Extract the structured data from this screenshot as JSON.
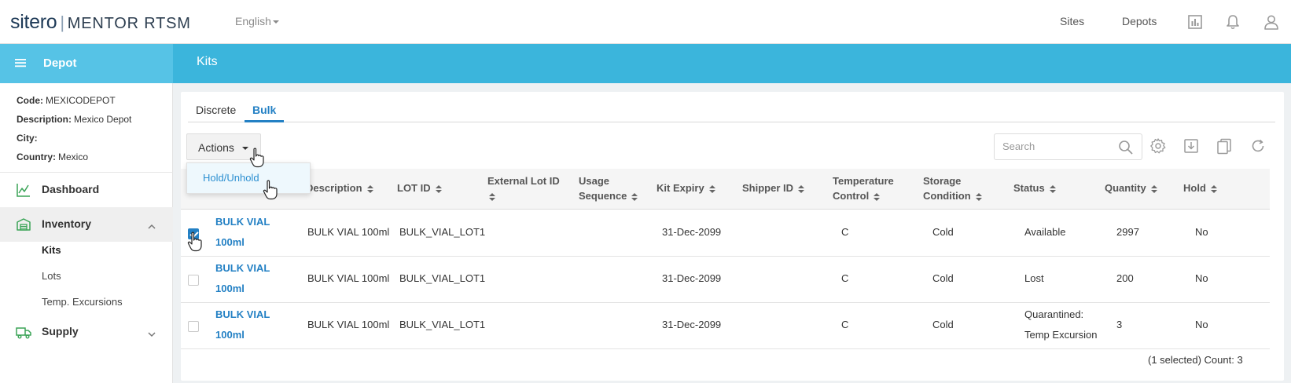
{
  "header": {
    "logo_brand": "sitero",
    "logo_separator": "|",
    "logo_product": "MENTOR RTSM",
    "language": "English",
    "nav_sites": "Sites",
    "nav_depots": "Depots",
    "icons": [
      "reports-icon",
      "bell-icon",
      "user-icon"
    ]
  },
  "sidebar": {
    "title": "Depot",
    "info": [
      {
        "label": "Code:",
        "value": "MEXICODEPOT"
      },
      {
        "label": "Description:",
        "value": "Mexico Depot"
      },
      {
        "label": "City:",
        "value": ""
      },
      {
        "label": "Country:",
        "value": "Mexico"
      }
    ],
    "nav": [
      {
        "label": "Dashboard",
        "icon": "chart-line-icon"
      },
      {
        "label": "Inventory",
        "icon": "warehouse-icon",
        "expanded": true,
        "children": [
          "Kits",
          "Lots",
          "Temp. Excursions"
        ],
        "active_child": "Kits"
      },
      {
        "label": "Supply",
        "icon": "truck-icon",
        "expanded": false
      }
    ]
  },
  "main": {
    "title": "Kits",
    "tabs": [
      {
        "label": "Discrete",
        "active": false
      },
      {
        "label": "Bulk",
        "active": true
      }
    ],
    "actions": {
      "label": "Actions",
      "menu_items": [
        "Hold/Unhold"
      ]
    },
    "search": {
      "placeholder": "Search",
      "value": ""
    },
    "toolbar_icons": [
      "settings-icon",
      "download-icon",
      "copy-icon",
      "refresh-icon"
    ],
    "table": {
      "columns": [
        "Description",
        "LOT ID",
        "External Lot ID",
        "Usage Sequence",
        "Kit Expiry",
        "Shipper ID",
        "Temperature Control",
        "Storage Condition",
        "Status",
        "Quantity",
        "Hold"
      ],
      "rows": [
        {
          "selected": true,
          "kit_line1": "BULK VIAL",
          "kit_line2": "100ml",
          "description": "BULK VIAL 100ml",
          "lot_id": "BULK_VIAL_LOT1",
          "external_lot_id": "",
          "usage_sequence": "",
          "kit_expiry": "31-Dec-2099",
          "shipper_id": "",
          "temperature_control": "C",
          "storage_condition": "Cold",
          "status_line1": "Available",
          "status_line2": "",
          "quantity": "2997",
          "hold": "No"
        },
        {
          "selected": false,
          "kit_line1": "BULK VIAL",
          "kit_line2": "100ml",
          "description": "BULK VIAL 100ml",
          "lot_id": "BULK_VIAL_LOT1",
          "external_lot_id": "",
          "usage_sequence": "",
          "kit_expiry": "31-Dec-2099",
          "shipper_id": "",
          "temperature_control": "C",
          "storage_condition": "Cold",
          "status_line1": "Lost",
          "status_line2": "",
          "quantity": "200",
          "hold": "No"
        },
        {
          "selected": false,
          "kit_line1": "BULK VIAL",
          "kit_line2": "100ml",
          "description": "BULK VIAL 100ml",
          "lot_id": "BULK_VIAL_LOT1",
          "external_lot_id": "",
          "usage_sequence": "",
          "kit_expiry": "31-Dec-2099",
          "shipper_id": "",
          "temperature_control": "C",
          "storage_condition": "Cold",
          "status_line1": "Quarantined:",
          "status_line2": "Temp Excursion",
          "quantity": "3",
          "hold": "No"
        }
      ],
      "footer": "(1 selected) Count: 3"
    }
  },
  "colors": {
    "brand_blue": "#3bb5dc",
    "sidebar_head": "#56c3e6",
    "link_blue": "#2380c4"
  }
}
